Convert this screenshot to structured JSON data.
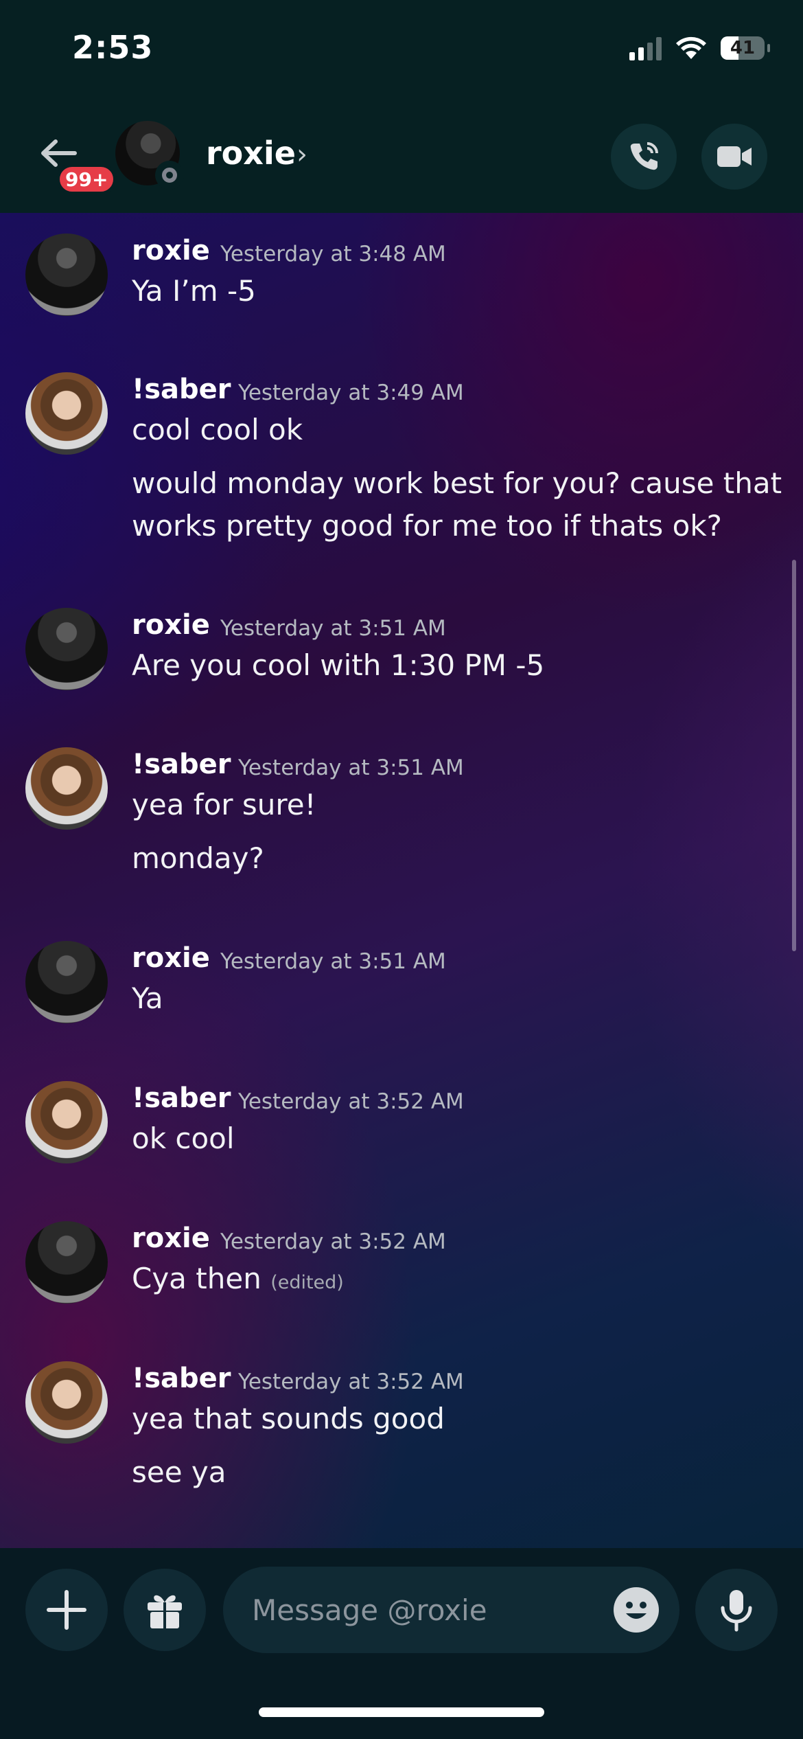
{
  "status_bar": {
    "time": "2:53",
    "battery": "41"
  },
  "header": {
    "badge": "99+",
    "contact_name": "roxie",
    "chevron": "›"
  },
  "messages": [
    {
      "author": "roxie",
      "timestamp": "Yesterday at 3:48 AM",
      "lines": [
        "Ya I’m -5"
      ]
    },
    {
      "author": "!saber",
      "timestamp": "Yesterday at 3:49 AM",
      "lines": [
        "cool cool ok",
        "would monday work best for you? cause that",
        "works pretty good for me too if thats ok?"
      ]
    },
    {
      "author": "roxie",
      "timestamp": "Yesterday at 3:51 AM",
      "lines": [
        "Are you cool with 1:30 PM -5"
      ]
    },
    {
      "author": "!saber",
      "timestamp": "Yesterday at 3:51 AM",
      "lines": [
        "yea for sure!",
        "monday?"
      ]
    },
    {
      "author": "roxie",
      "timestamp": "Yesterday at 3:51 AM",
      "lines": [
        "Ya"
      ]
    },
    {
      "author": "!saber",
      "timestamp": "Yesterday at 3:52 AM",
      "lines": [
        "ok cool"
      ]
    },
    {
      "author": "roxie",
      "timestamp": "Yesterday at 3:52 AM",
      "lines": [
        "Cya then"
      ],
      "edited": "(edited)"
    },
    {
      "author": "!saber",
      "timestamp": "Yesterday at 3:52 AM",
      "lines": [
        "yea that sounds good",
        "see ya"
      ]
    }
  ],
  "composer": {
    "placeholder": "Message @roxie"
  },
  "icons": {
    "back": "back-arrow-icon",
    "call": "phone-call-icon",
    "video": "video-camera-icon",
    "add": "plus-icon",
    "gift": "gift-icon",
    "emoji": "emoji-icon",
    "mic": "microphone-icon"
  },
  "colors": {
    "badge": "#e63c47",
    "header_bg": "#062022",
    "composer_bg": "#071a22"
  }
}
